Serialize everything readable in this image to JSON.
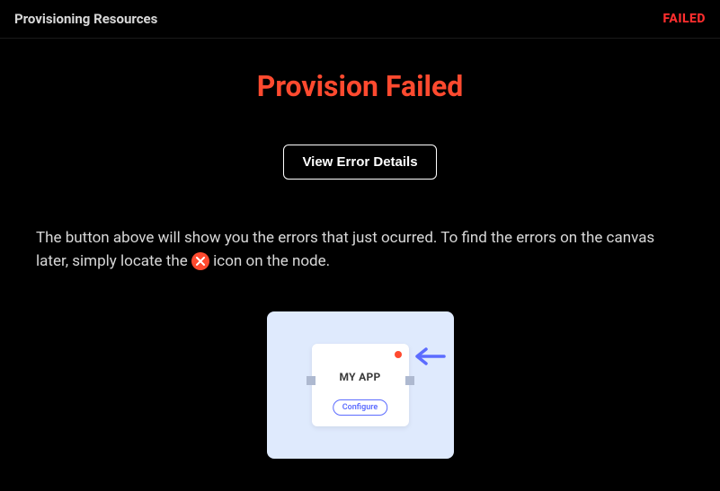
{
  "header": {
    "title": "Provisioning Resources",
    "status": "FAILED"
  },
  "main": {
    "heading": "Provision Failed",
    "button_label": "View Error Details",
    "description_pre": "The button above will show you the errors that just ocurred. To find the errors on the canvas later, simply locate the ",
    "description_post": " icon on the node."
  },
  "illustration": {
    "node_title": "MY APP",
    "node_button": "Configure"
  },
  "colors": {
    "accent_error": "#ff4a2f",
    "status_red": "#ff2e2e",
    "canvas_bg": "#dfeafd",
    "arrow": "#5c6cff"
  }
}
